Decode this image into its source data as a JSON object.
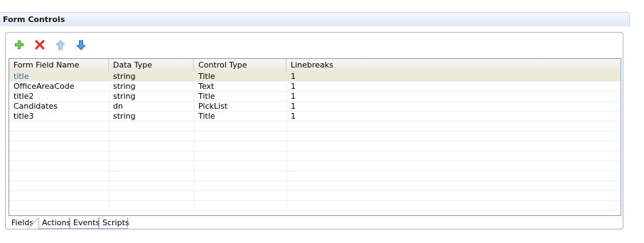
{
  "section": {
    "title": "Form Controls"
  },
  "toolbar": {
    "add_icon": "add-icon",
    "delete_icon": "delete-icon",
    "move_up_icon": "move-up-icon",
    "move_down_icon": "move-down-icon"
  },
  "table": {
    "headers": [
      "Form Field Name",
      "Data Type",
      "Control Type",
      "Linebreaks"
    ],
    "rows": [
      [
        "title",
        "string",
        "Title",
        "1"
      ],
      [
        "OfficeAreaCode",
        "string",
        "Text",
        "1"
      ],
      [
        "title2",
        "string",
        "Title",
        "1"
      ],
      [
        "Candidates",
        "dn",
        "PickList",
        "1"
      ],
      [
        "title3",
        "string",
        "Title",
        "1"
      ]
    ],
    "selected_row": 0
  },
  "tabs": [
    "Fields",
    "Actions",
    "Events",
    "Scripts"
  ],
  "active_tab": "Fields",
  "colors": {
    "header_bg": "#dfe9f6",
    "selected_row_bg": "#ece9d8",
    "link_text": "#2e6ea7",
    "add_green": "#3d9a27",
    "delete_red": "#d93a2b",
    "arrow_up": "#8fb6e0",
    "arrow_down": "#3f86d4"
  }
}
